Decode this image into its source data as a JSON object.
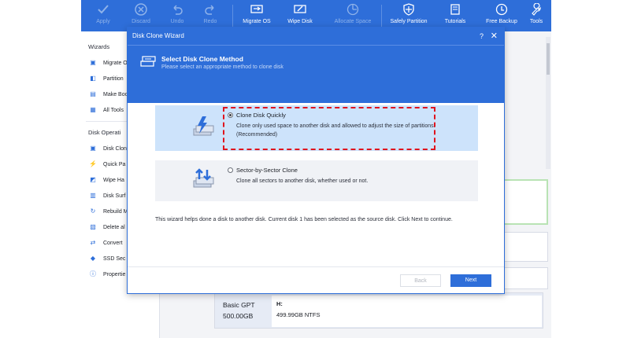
{
  "toolbar": {
    "apply": "Apply",
    "discard": "Discard",
    "undo": "Undo",
    "redo": "Redo",
    "migrate_os": "Migrate OS",
    "wipe_disk": "Wipe Disk",
    "allocate_space": "Allocate Space",
    "safely_partition": "Safely Partition",
    "tutorials": "Tutorials",
    "free_backup": "Free Backup",
    "tools": "Tools"
  },
  "sidebar": {
    "wizards_head": "Wizards",
    "wizards": [
      "Migrate O",
      "Partition",
      "Make Boo",
      "All Tools"
    ],
    "disk_ops_head": "Disk Operati",
    "disk_ops": [
      "Disk Clon",
      "Quick Pa",
      "Wipe Ha",
      "Disk Surf",
      "Rebuild M",
      "Delete al",
      "Convert",
      "SSD Sec",
      "Propertie"
    ]
  },
  "disk": {
    "type": "Basic GPT",
    "size": "500.00GB",
    "partition_letter": "H:",
    "partition_info": "499.99GB NTFS"
  },
  "dialog": {
    "title": "Disk Clone Wizard",
    "help_glyph": "?",
    "close_glyph": "✕",
    "header_title": "Select Disk Clone Method",
    "header_subtitle": "Please select an appropriate method to clone disk",
    "options": [
      {
        "label": "Clone Disk Quickly",
        "desc": "Clone only used space to another disk and allowed to adjust the size of partitions. (Recommended)",
        "selected": true
      },
      {
        "label": "Sector-by-Sector Clone",
        "desc": "Clone all sectors to another disk, whether used or not.",
        "selected": false
      }
    ],
    "note": "This wizard helps done a disk to another disk. Current disk 1 has been selected as the source disk. Click Next to continue.",
    "back_label": "Back",
    "next_label": "Next"
  },
  "colors": {
    "accent": "#2e6ed9",
    "selected_option": "#cde3fb",
    "highlight": "#e0141e"
  }
}
